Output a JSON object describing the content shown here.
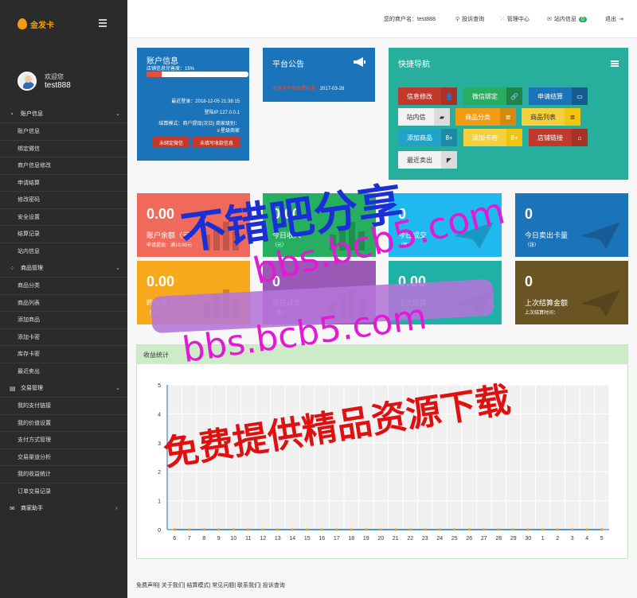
{
  "brand": {
    "name": "金发卡"
  },
  "sidebar": {
    "welcome": "欢迎您",
    "username": "test888",
    "groups": [
      {
        "title": "账户信息",
        "icon": "dashboard-icon",
        "items": [
          "账户信息",
          "绑定微信",
          "商户信息修改",
          "申请结算",
          "修改密码",
          "安全设置",
          "结算记录",
          "站内信息"
        ]
      },
      {
        "title": "商品管理",
        "icon": "grid-icon",
        "items": [
          "商品分类",
          "商品列表",
          "添加商品",
          "添加卡密",
          "库存卡密",
          "最近卖出"
        ]
      },
      {
        "title": "交易管理",
        "icon": "document-icon",
        "items": [
          "我的支付链接",
          "我的价值设置",
          "支付方式管理",
          "交易渠道分析",
          "我的收益统计",
          "订单交易记录"
        ]
      },
      {
        "title": "商家助手",
        "icon": "mail-icon",
        "items": []
      }
    ]
  },
  "topbar": {
    "merchant": "您的商户名：test888",
    "complaint": "投诉查询",
    "admin": "管理中心",
    "messages": "站内信息",
    "messages_count": "0",
    "logout": "退出"
  },
  "account": {
    "title": "账户信息",
    "completion": "店铺信息完善度：15%",
    "completion_pct": 0.15,
    "last_login": "最近登录：2018-12-05 21:38:15",
    "ip": "登陆IP:127.0.0.1",
    "mode": "结算模式：商户提现(次日) 商家级别：",
    "level": "星级商家",
    "btn_wechat": "未绑定微信",
    "btn_payment": "未填写收款信息"
  },
  "announce": {
    "title": "平台公告",
    "link": "金发卡平台收费标准",
    "date": "2017-03-28"
  },
  "quicknav": {
    "title": "快捷导航",
    "buttons": [
      {
        "label": "信息修改",
        "icon": "user-icon"
      },
      {
        "label": "微信绑定",
        "icon": "link-icon"
      },
      {
        "label": "申请结算",
        "icon": "card-icon"
      },
      {
        "label": "站内信",
        "icon": "message-icon"
      },
      {
        "label": "商品分类",
        "icon": "list-icon"
      },
      {
        "label": "商品列表",
        "icon": "list-icon"
      },
      {
        "label": "添加商品",
        "icon": "plus-icon"
      },
      {
        "label": "添加卡密",
        "icon": "plus-icon"
      },
      {
        "label": "店铺链接",
        "icon": "home-icon"
      },
      {
        "label": "最近卖出",
        "icon": "tag-icon"
      }
    ]
  },
  "tiles": [
    {
      "value": "0.00",
      "label": "账户余额（元）",
      "sub": "申请提现：满10.00元"
    },
    {
      "value": "0.00",
      "label": "今日收入",
      "sub": "（元）"
    },
    {
      "value": "0",
      "label": "今日成交",
      "sub": "（笔）"
    },
    {
      "value": "0",
      "label": "今日卖出卡量",
      "sub": "（张）"
    },
    {
      "value": "0.00",
      "label": "昨日收入",
      "sub": "（元）"
    },
    {
      "value": "0",
      "label": "昨日成交",
      "sub": "（笔）"
    },
    {
      "value": "0.00",
      "label": "上次结算",
      "sub": "（元）"
    },
    {
      "value": "0",
      "label": "上次结算金额",
      "sub": "上次结算时间："
    }
  ],
  "chart_title": "收益统计",
  "chart_data": {
    "type": "line",
    "categories": [
      "6",
      "7",
      "8",
      "9",
      "10",
      "11",
      "12",
      "13",
      "14",
      "15",
      "16",
      "17",
      "18",
      "19",
      "20",
      "21",
      "22",
      "23",
      "24",
      "25",
      "26",
      "27",
      "28",
      "29",
      "30",
      "1",
      "2",
      "3",
      "4",
      "5"
    ],
    "series": [
      {
        "values": [
          0,
          0,
          0,
          0,
          0,
          0,
          0,
          0,
          0,
          0,
          0,
          0,
          0,
          0,
          0,
          0,
          0,
          0,
          0,
          0,
          0,
          0,
          0,
          0,
          0,
          0,
          0,
          0,
          0,
          0
        ]
      }
    ],
    "ylim": [
      0,
      5
    ],
    "yticks": [
      "0",
      "1",
      "2",
      "3",
      "4",
      "5"
    ],
    "grid": true,
    "colors": {
      "line": "#1b73b9",
      "marker": "#f39c12"
    }
  },
  "watermark": {
    "line1": "不错吧分享",
    "line2": "bbs.bcb5.com",
    "line3": "bbs.bcb5.com",
    "line4": "免费提供精品资源下载",
    "colors": {
      "blue": "#1a2fd6",
      "magenta": "#e21ad6",
      "red": "#e01010"
    }
  },
  "footer": {
    "text": "免费声明| 关于我们| 结算模式| 常见问题| 联系我们| 投诉查询"
  }
}
